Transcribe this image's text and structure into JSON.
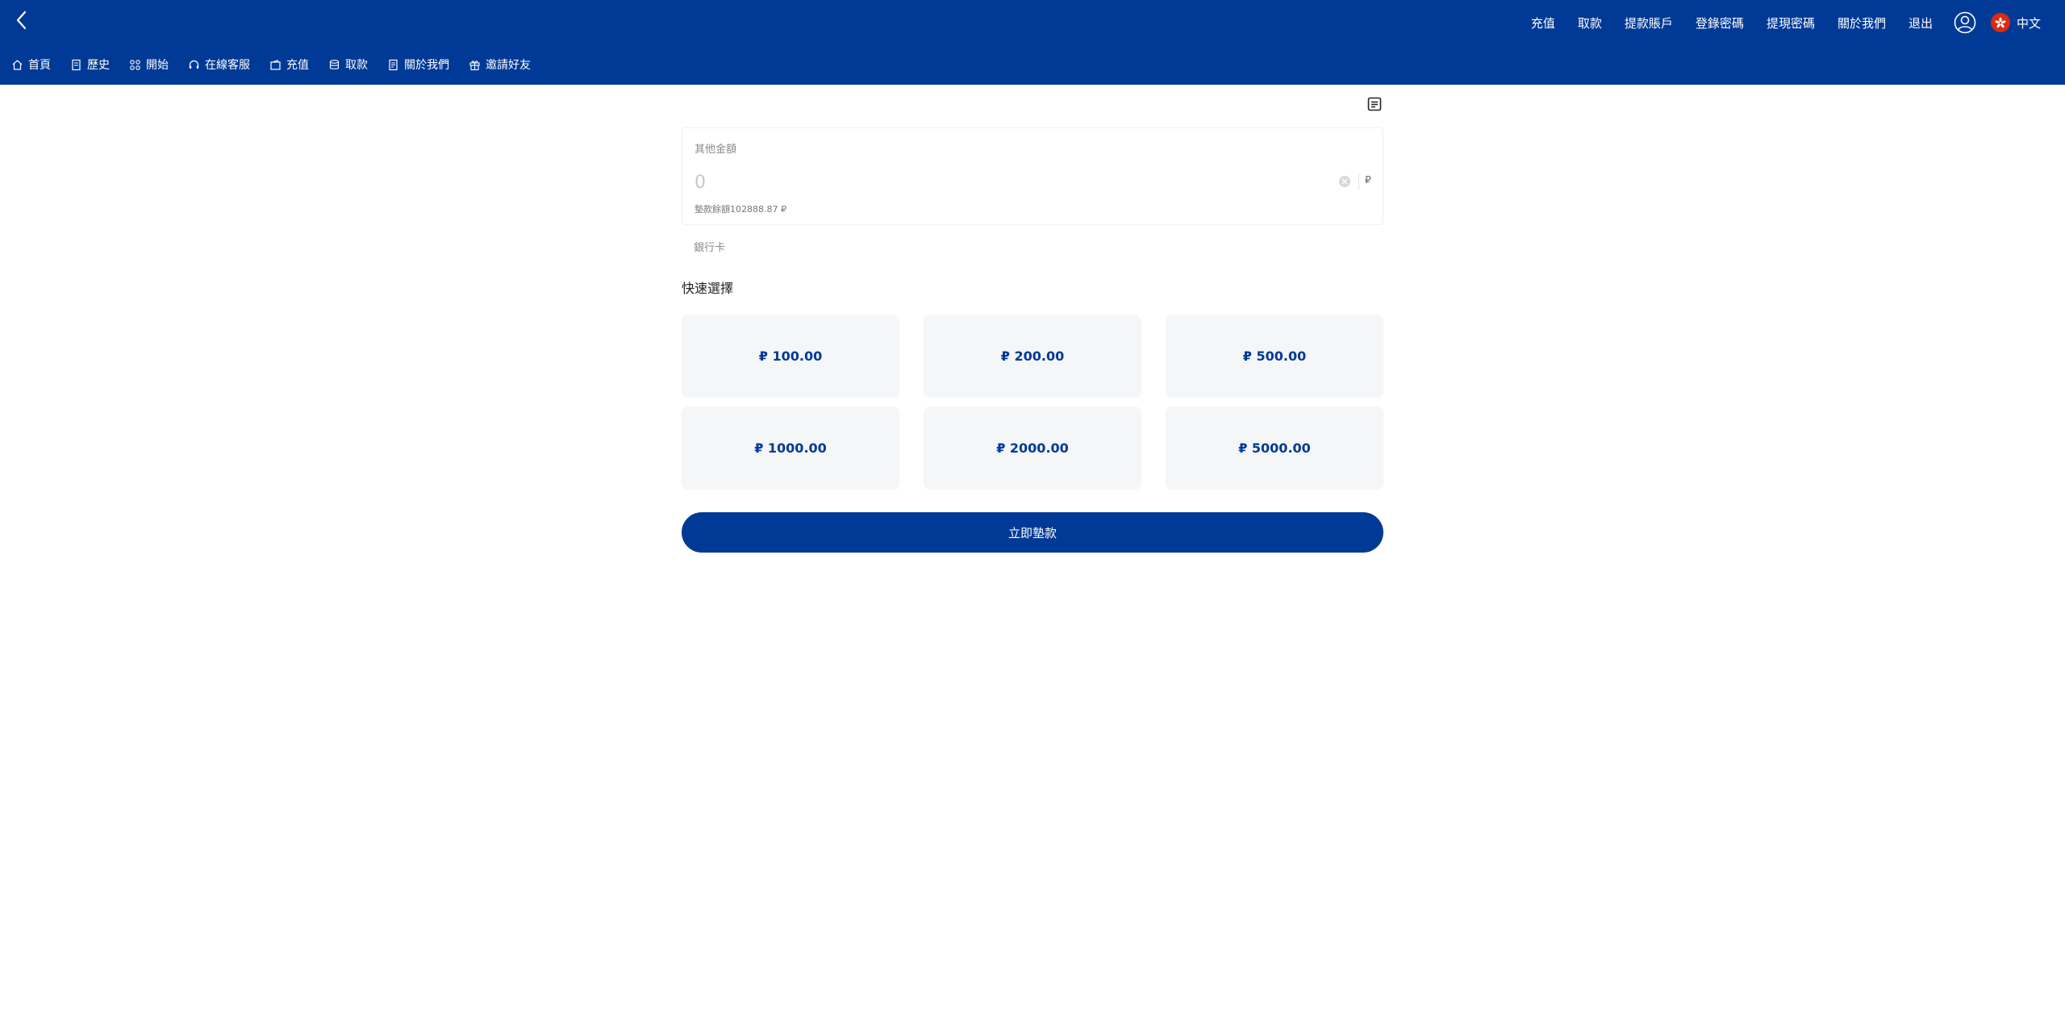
{
  "header": {
    "top_links": [
      "充值",
      "取款",
      "提款賬戶",
      "登錄密碼",
      "提現密碼",
      "關於我們",
      "退出"
    ],
    "language": "中文"
  },
  "nav": [
    {
      "label": "首頁",
      "icon": "home-icon"
    },
    {
      "label": "歷史",
      "icon": "history-icon"
    },
    {
      "label": "開始",
      "icon": "grid-icon"
    },
    {
      "label": "在線客服",
      "icon": "headset-icon"
    },
    {
      "label": "充值",
      "icon": "wallet-icon"
    },
    {
      "label": "取款",
      "icon": "coins-icon"
    },
    {
      "label": "關於我們",
      "icon": "document-icon"
    },
    {
      "label": "邀請好友",
      "icon": "gift-icon"
    }
  ],
  "form": {
    "amount_title": "其他金額",
    "amount_placeholder": "0",
    "currency_symbol": "₽",
    "balance_text": "墊款餘額102888.87 ₽",
    "bank_label": "銀行卡",
    "quick_title": "快速選擇",
    "quick_amounts": [
      "₽ 100.00",
      "₽ 200.00",
      "₽ 500.00",
      "₽ 1000.00",
      "₽ 2000.00",
      "₽ 5000.00"
    ],
    "submit_label": "立即墊款"
  },
  "colors": {
    "brand": "#003a96",
    "tile_bg": "#f5f6f8"
  }
}
